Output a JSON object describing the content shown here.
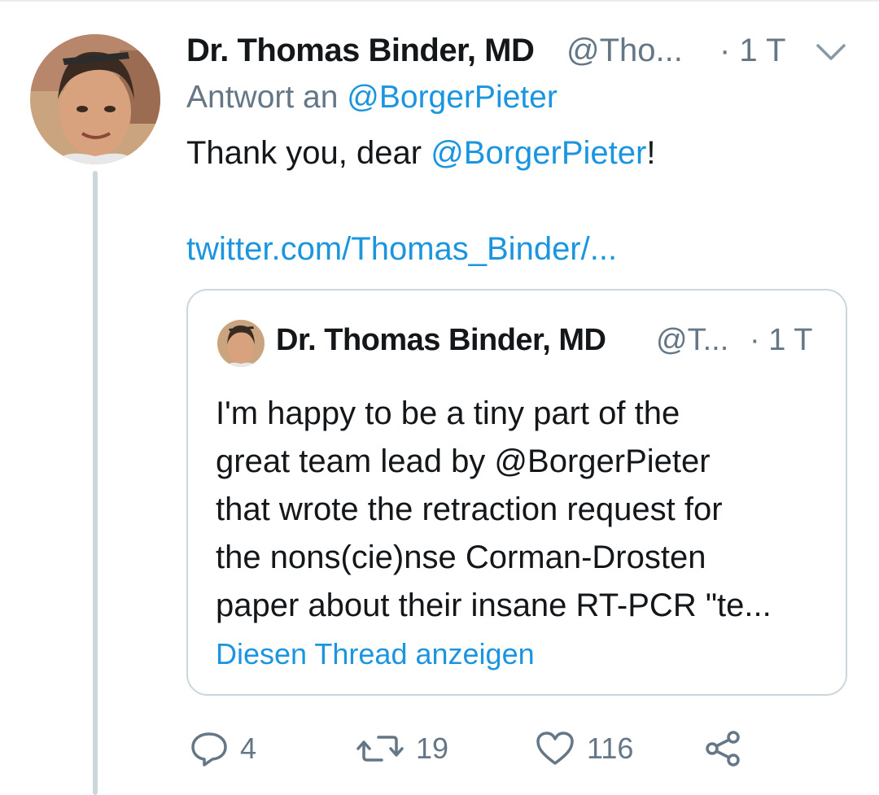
{
  "tweet": {
    "author_name": "Dr. Thomas Binder, MD",
    "author_handle": "@Tho...",
    "timestamp": "· 1 T",
    "reply_prefix": "Antwort an",
    "reply_to": "@BorgerPieter",
    "body_prefix": "Thank you, dear ",
    "body_mention": "@BorgerPieter",
    "body_suffix": "!",
    "link": "twitter.com/Thomas_Binder/..."
  },
  "quoted_tweet": {
    "author_name": "Dr. Thomas Binder, MD",
    "author_handle": "@T...",
    "timestamp": "· 1 T",
    "lines": [
      "I'm happy to be a tiny part of the",
      "great team lead by @BorgerPieter",
      "that wrote the retraction request for",
      "the nons(cie)nse Corman-Drosten",
      "paper about their insane RT-PCR \"te..."
    ],
    "show_thread": "Diesen Thread anzeigen"
  },
  "actions": {
    "reply_count": "4",
    "retweet_count": "19",
    "like_count": "116"
  },
  "colors": {
    "link": "#1b95e0",
    "secondary_text": "#657786",
    "border": "#ccd6dd",
    "primary_text": "#14171a"
  },
  "icons": [
    "chevron-down-icon",
    "reply-icon",
    "retweet-icon",
    "heart-icon",
    "share-icon"
  ]
}
